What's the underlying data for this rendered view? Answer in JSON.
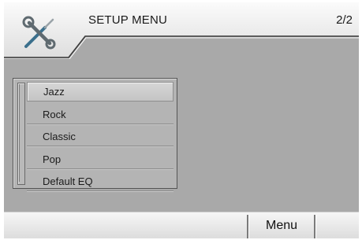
{
  "header": {
    "title": "SETUP MENU",
    "page_indicator": "2/2",
    "icon": "tools-icon"
  },
  "list": {
    "items": [
      {
        "label": "Jazz",
        "selected": true
      },
      {
        "label": "Rock",
        "selected": false
      },
      {
        "label": "Classic",
        "selected": false
      },
      {
        "label": "Pop",
        "selected": false
      },
      {
        "label": "Default EQ",
        "selected": false
      }
    ]
  },
  "footer": {
    "menu_label": "Menu"
  },
  "colors": {
    "background": "#a9a9a9",
    "header_top": "#f2f2f2",
    "footer_top": "#f6f6f6"
  }
}
